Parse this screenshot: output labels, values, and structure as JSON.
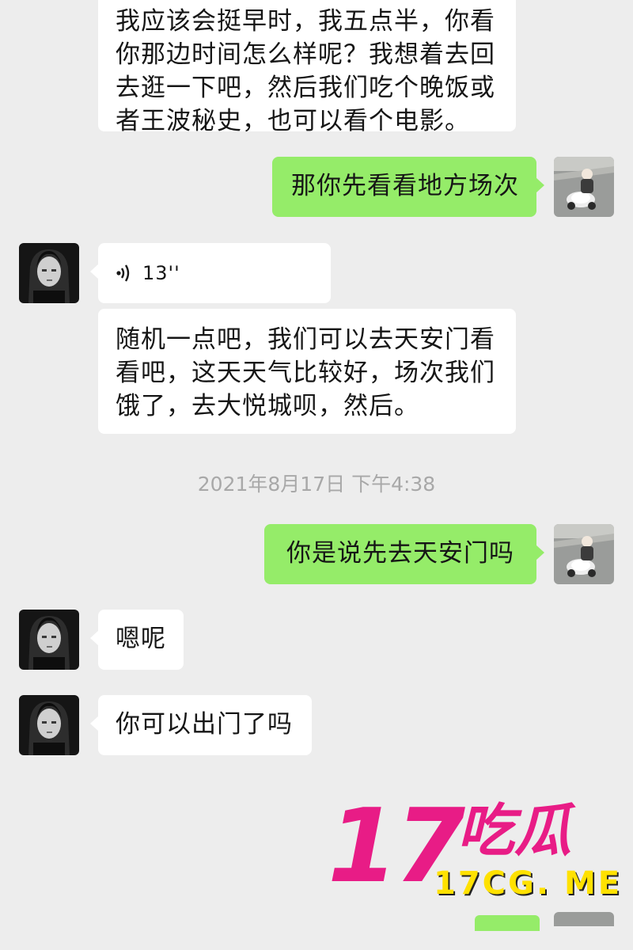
{
  "colors": {
    "background": "#ededed",
    "incoming_bubble": "#ffffff",
    "outgoing_bubble": "#95ec69",
    "timestamp_text": "#a8a8a8",
    "watermark_pink": "#e81c86",
    "watermark_yellow": "#ffe100"
  },
  "messages": [
    {
      "direction": "incoming",
      "lines": [
        "我应该会挺早时，我五点半，你看",
        "你那边时间怎么样呢？我想着去回",
        "去逛一下吧，然后我们吃个晚饭或",
        "者王波秘史，也可以看个电影。"
      ]
    },
    {
      "direction": "outgoing",
      "text": "那你先看看地方场次",
      "avatar": "toddler-on-toy-car-avatar"
    },
    {
      "direction": "incoming",
      "type": "voice",
      "duration": "13''",
      "icon": "voice-wave-icon",
      "avatar": "dark-portrait-avatar"
    },
    {
      "direction": "incoming",
      "lines": [
        "随机一点吧，我们可以去天安门看",
        "看吧，这天天气比较好，场次我们",
        "饿了，去大悦城呗，然后。"
      ]
    },
    {
      "direction": "outgoing",
      "text": "你是说先去天安门吗",
      "avatar": "toddler-on-toy-car-avatar"
    },
    {
      "direction": "incoming",
      "text": "嗯呢",
      "avatar": "dark-portrait-avatar"
    },
    {
      "direction": "incoming",
      "text": "你可以出门了吗",
      "avatar": "dark-portrait-avatar"
    }
  ],
  "timestamp": "2021年8月17日 下午4:38",
  "watermark": {
    "number": "17",
    "chinese": "吃瓜",
    "url": "17CG. ME"
  }
}
